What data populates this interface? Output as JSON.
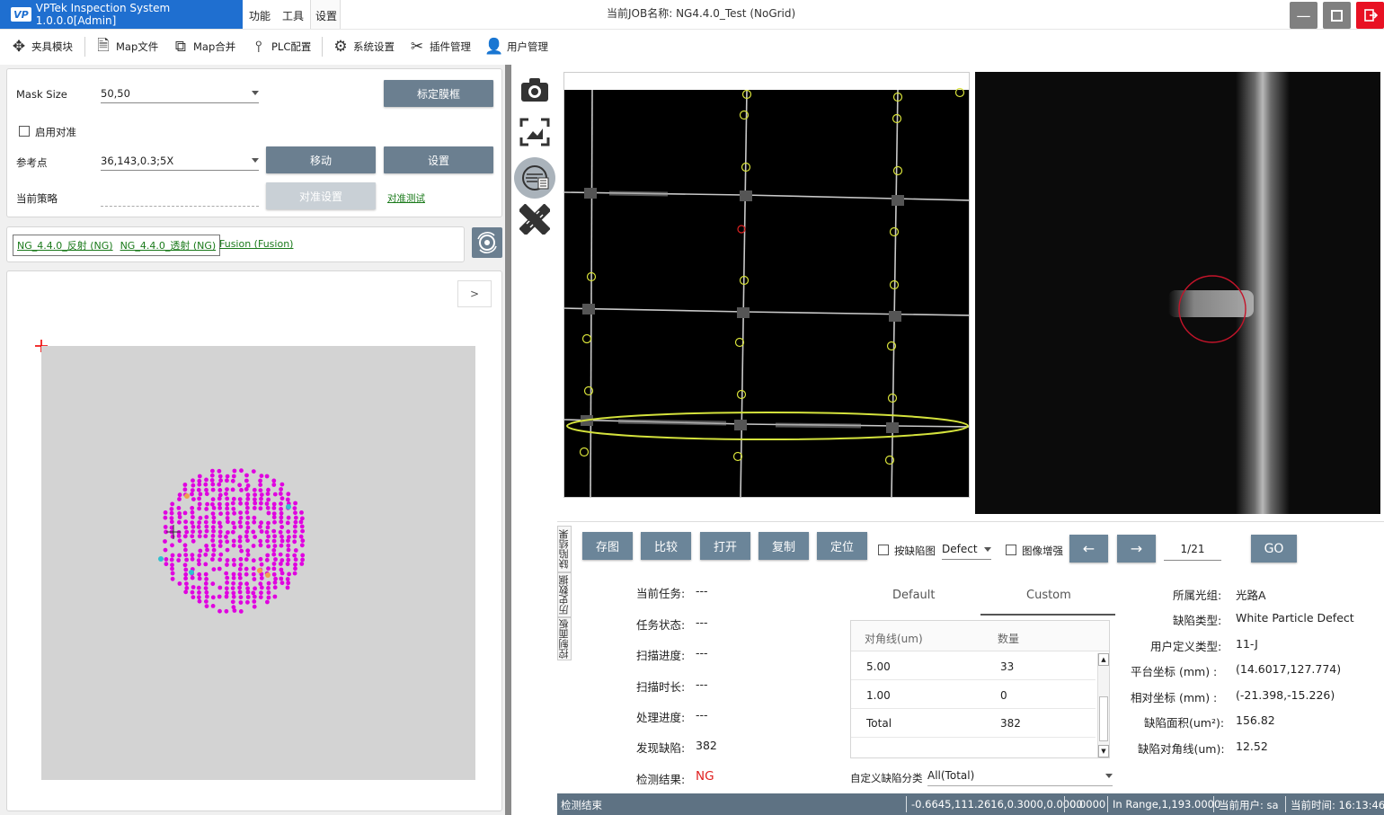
{
  "app": {
    "title": "VPTek Inspection System 1.0.0.0[Admin]",
    "logo_text": "VP",
    "menu": [
      "功能",
      "工具",
      "设置"
    ],
    "job_title": "当前JOB名称:  NG4.4.0_Test (NoGrid)"
  },
  "window_controls": [
    "minimize-icon",
    "maximize-icon",
    "exit-icon"
  ],
  "toolbar": [
    {
      "label": "夹具模块",
      "icon": "fixture-icon"
    },
    {
      "label": "Map文件",
      "icon": "document-icon"
    },
    {
      "label": "Map合并",
      "icon": "merge-icon"
    },
    {
      "label": "PLC配置",
      "icon": "plc-icon"
    },
    {
      "label": "系统设置",
      "icon": "gear-icon"
    },
    {
      "label": "插件管理",
      "icon": "tools-icon"
    },
    {
      "label": "用户管理",
      "icon": "user-icon"
    }
  ],
  "mask": {
    "mask_size_label": "Mask Size",
    "mask_size_value": "50,50",
    "calibrate_button": "标定膜框",
    "enable_align_label": "启用对准",
    "ref_point_label": "参考点",
    "ref_point_value": "36,143,0.3;5X",
    "move_button": "移动",
    "set_button": "设置",
    "strategy_label": "当前策略",
    "strategy_value": "",
    "align_settings_button": "对准设置",
    "align_test_link": "对准测试"
  },
  "job_tabs": {
    "reflect": "NG_4.4.0_反射 (NG)",
    "transmit": "NG_4.4.0_透射 (NG)",
    "fusion": "Fusion (Fusion)"
  },
  "wafer_map": {
    "expand_button": ">"
  },
  "action_buttons": [
    "存图",
    "比较",
    "打开",
    "复制",
    "定位"
  ],
  "filters": {
    "by_defect_label": "按缺陷图",
    "defect_select": "Defect",
    "image_enhance_label": "图像增强",
    "prev_icon": "←",
    "next_icon": "→",
    "page": "1/21",
    "go_button": "GO"
  },
  "side_tabs": [
    "缺陷结果",
    "历史数据",
    "控制面板"
  ],
  "task_info": [
    {
      "label": "当前任务:",
      "value": "---"
    },
    {
      "label": "任务状态:",
      "value": "---"
    },
    {
      "label": "扫描进度:",
      "value": "---"
    },
    {
      "label": "扫描时长:",
      "value": "---"
    },
    {
      "label": "处理进度:",
      "value": "---"
    },
    {
      "label": "发现缺陷:",
      "value": "382"
    },
    {
      "label": "检测结果:",
      "value": "NG"
    }
  ],
  "result_tabs": {
    "default": "Default",
    "custom": "Custom"
  },
  "defect_table": {
    "headers": [
      "对角线(um)",
      "数量"
    ],
    "rows": [
      [
        "5.00",
        "33"
      ],
      [
        "1.00",
        "0"
      ],
      [
        "Total",
        "382"
      ]
    ]
  },
  "custom_class": {
    "label": "自定义缺陷分类",
    "value": "All(Total)"
  },
  "defect_info": [
    {
      "label": "所属光组:",
      "value": "光路A"
    },
    {
      "label": "缺陷类型:",
      "value": "White Particle Defect"
    },
    {
      "label": "用户定义类型:",
      "value": "11-J"
    },
    {
      "label": "平台坐标 (mm) :",
      "value": "(14.6017,127.774)"
    },
    {
      "label": "相对坐标 (mm) :",
      "value": "(-21.398,-15.226)"
    },
    {
      "label": "缺陷面积(um²):",
      "value": "156.82"
    },
    {
      "label": "缺陷对角线(um):",
      "value": "12.52"
    }
  ],
  "status_bar": {
    "state": "检测结束",
    "coords": "-0.6645,111.2616,0.3000,0.0000",
    "value": "0.0000",
    "range": "In Range,1,193.0000",
    "user": "当前用户:  sa",
    "time": "当前时间:  16:13:46"
  },
  "colors": {
    "title_blue": "#1f6fd0",
    "button_gray": "#6b7f90",
    "defect_dot": "#e000e0",
    "ng_red": "#e02020",
    "status_bar": "#5e7283"
  }
}
